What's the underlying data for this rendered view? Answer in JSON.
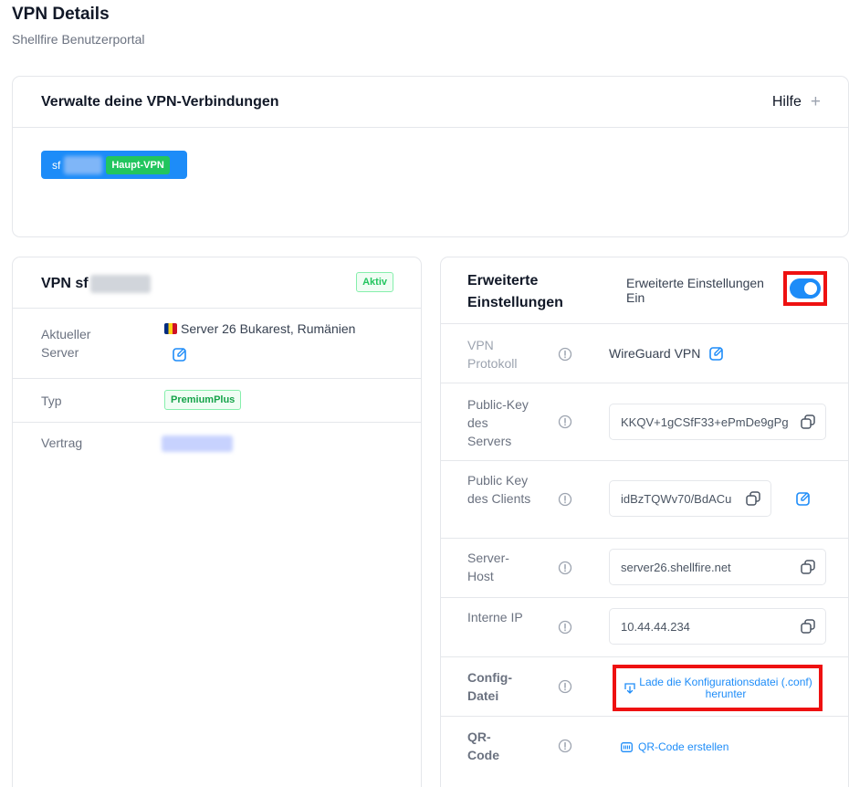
{
  "header": {
    "title": "VPN Details",
    "subtitle": "Shellfire Benutzerportal"
  },
  "connections": {
    "title": "Verwalte deine VPN-Verbindungen",
    "help_label": "Hilfe",
    "chip": {
      "name_prefix": "sf",
      "badge": "Haupt-VPN"
    }
  },
  "vpn_card": {
    "title_prefix": "VPN sf",
    "status_badge": "Aktiv",
    "rows": {
      "server": {
        "label": "Aktueller Server",
        "value": "Server 26 Bukarest, Rumänien"
      },
      "type": {
        "label": "Typ",
        "value": "PremiumPlus"
      },
      "contract": {
        "label": "Vertrag"
      }
    }
  },
  "advanced": {
    "title": "Erweiterte Einstellungen",
    "toggle_label": "Erweiterte Einstellungen Ein",
    "toggle_on": true,
    "rows": {
      "protocol": {
        "label": "VPN Protokoll",
        "value": "WireGuard VPN"
      },
      "server_key": {
        "label": "Public-Key des Servers",
        "value": "KKQV+1gCSfF33+ePmDe9gPg"
      },
      "client_key": {
        "label": "Public Key des Clients",
        "value": "idBzTQWv70/BdACu"
      },
      "server_host": {
        "label": "Server-Host",
        "value": "server26.shellfire.net"
      },
      "internal_ip": {
        "label": "Interne IP",
        "value": "10.44.44.234"
      },
      "config": {
        "label": "Config-Datei",
        "button": "Lade die Konfigurationsdatei (.conf) herunter"
      },
      "qr": {
        "label": "QR-Code",
        "button": "QR-Code erstellen"
      }
    }
  },
  "colors": {
    "accent": "#1d8cf8",
    "success": "#22c55e",
    "highlight": "#ee1111"
  }
}
